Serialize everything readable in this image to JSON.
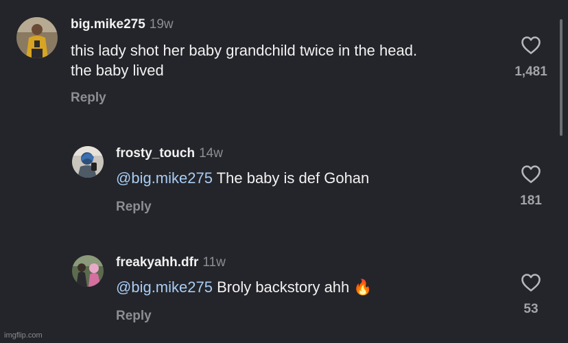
{
  "comments": [
    {
      "username": "big.mike275",
      "time": "19w",
      "text_line1": "this lady shot her baby grandchild twice in the head.",
      "text_line2": "the baby lived",
      "reply_label": "Reply",
      "likes": "1,481"
    },
    {
      "username": "frosty_touch",
      "time": "14w",
      "mention": "@big.mike275",
      "text": " The baby is def Gohan",
      "reply_label": "Reply",
      "likes": "181"
    },
    {
      "username": "freakyahh.dfr",
      "time": "11w",
      "mention": "@big.mike275",
      "text": " Broly backstory ahh ",
      "emoji": "🔥",
      "reply_label": "Reply",
      "likes": "53"
    }
  ],
  "watermark": "imgflip.com",
  "icons": {
    "like": "heart-outline-icon"
  },
  "colors": {
    "background": "#24252a",
    "mention": "#a9cdf5",
    "muted": "#8d8e93"
  }
}
